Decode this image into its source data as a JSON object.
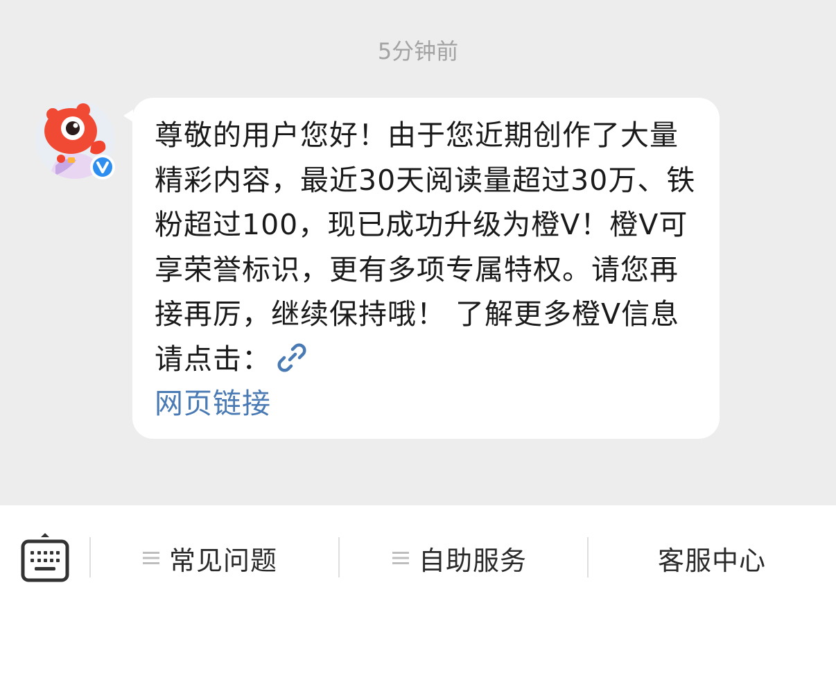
{
  "chat": {
    "timestamp": "5分钟前",
    "message": {
      "text": "尊敬的用户您好！由于您近期创作了大量精彩内容，最近30天阅读量超过30万、铁粉超过100，现已成功升级为橙V！橙V可享荣誉标识，更有多项专属特权。请您再接再厉，继续保持哦！ 了解更多橙V信息请点击：",
      "link_icon": "link-icon",
      "link_text": "网页链接",
      "link_color": "#4a7ab4"
    },
    "avatar": {
      "icon": "mascot-avatar",
      "badge_icon": "verified-v-badge",
      "badge_color": "#2e8ef0"
    }
  },
  "bottom_bar": {
    "keyboard_icon": "keyboard-icon",
    "menu": [
      {
        "label": "常见问题",
        "icon": "menu-lines-icon"
      },
      {
        "label": "自助服务",
        "icon": "menu-lines-icon"
      },
      {
        "label": "客服中心",
        "icon": ""
      }
    ]
  }
}
